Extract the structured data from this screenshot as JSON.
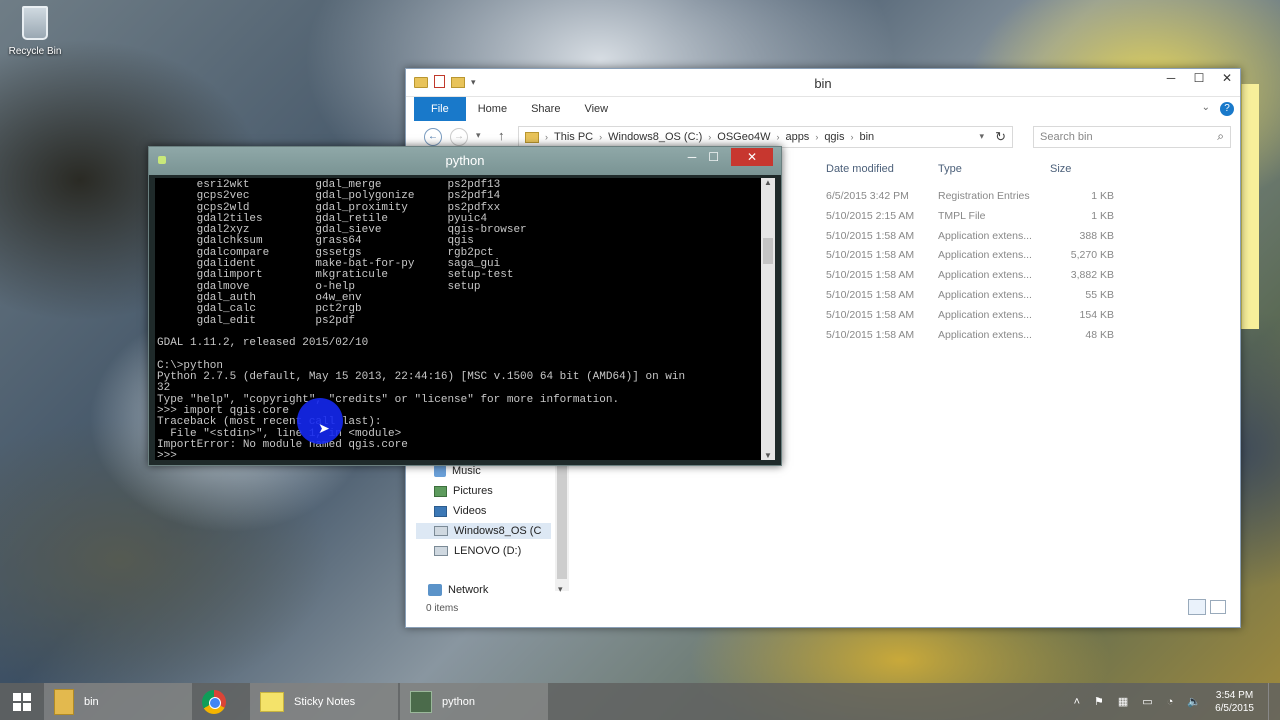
{
  "desktop": {
    "recycle_bin_label": "Recycle Bin"
  },
  "explorer": {
    "title": "bin",
    "ribbon_tabs": [
      "File",
      "Home",
      "Share",
      "View"
    ],
    "address": {
      "crumbs": [
        "This PC",
        "Windows8_OS (C:)",
        "OSGeo4W",
        "apps",
        "qgis",
        "bin"
      ]
    },
    "search": {
      "placeholder": "Search bin"
    },
    "columns": {
      "date": "Date modified",
      "type": "Type",
      "size": "Size"
    },
    "rows": [
      {
        "date": "6/5/2015 3:42 PM",
        "type": "Registration Entries",
        "size": "1 KB"
      },
      {
        "date": "5/10/2015 2:15 AM",
        "type": "TMPL File",
        "size": "1 KB"
      },
      {
        "date": "5/10/2015 1:58 AM",
        "type": "Application extens...",
        "size": "388 KB"
      },
      {
        "date": "5/10/2015 1:58 AM",
        "type": "Application extens...",
        "size": "5,270 KB"
      },
      {
        "date": "5/10/2015 1:58 AM",
        "type": "Application extens...",
        "size": "3,882 KB"
      },
      {
        "date": "5/10/2015 1:58 AM",
        "type": "Application extens...",
        "size": "55 KB"
      },
      {
        "date": "5/10/2015 1:58 AM",
        "type": "Application extens...",
        "size": "154 KB"
      },
      {
        "date": "5/10/2015 1:58 AM",
        "type": "Application extens...",
        "size": "48 KB"
      }
    ],
    "nav": {
      "music": "Music",
      "pictures": "Pictures",
      "videos": "Videos",
      "windows_drive": "Windows8_OS (C",
      "lenovo_drive": "LENOVO (D:)",
      "network": "Network"
    },
    "status": "0 items"
  },
  "console": {
    "title": "python",
    "text": "      esri2wkt          gdal_merge          ps2pdf13\n      gcps2vec          gdal_polygonize     ps2pdf14\n      gcps2wld          gdal_proximity      ps2pdfxx\n      gdal2tiles        gdal_retile         pyuic4\n      gdal2xyz          gdal_sieve          qgis-browser\n      gdalchksum        grass64             qgis\n      gdalcompare       gssetgs             rgb2pct\n      gdalident         make-bat-for-py     saga_gui\n      gdalimport        mkgraticule         setup-test\n      gdalmove          o-help              setup\n      gdal_auth         o4w_env\n      gdal_calc         pct2rgb\n      gdal_edit         ps2pdf\n\nGDAL 1.11.2, released 2015/02/10\n\nC:\\>python\nPython 2.7.5 (default, May 15 2013, 22:44:16) [MSC v.1500 64 bit (AMD64)] on win\n32\nType \"help\", \"copyright\", \"credits\" or \"license\" for more information.\n>>> import qgis.core\nTraceback (most recent call last):\n  File \"<stdin>\", line 1, in <module>\nImportError: No module named qgis.core\n>>>"
  },
  "taskbar": {
    "items": [
      "bin",
      "Sticky Notes",
      "python"
    ],
    "clock_time": "3:54 PM",
    "clock_date": "6/5/2015"
  }
}
